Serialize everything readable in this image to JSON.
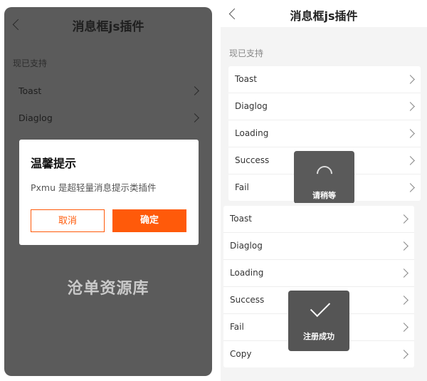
{
  "left_screen": {
    "title": "消息框js插件",
    "section_label": "现已支持",
    "items": [
      {
        "label": "Toast"
      },
      {
        "label": "Diaglog"
      }
    ],
    "watermark": "沧单资源库",
    "dialog": {
      "title": "温馨提示",
      "message": "Pxmu 是超轻量消息提示类插件",
      "cancel_label": "取消",
      "confirm_label": "确定"
    }
  },
  "right_top_screen": {
    "title": "消息框js插件",
    "section_label": "现已支持",
    "items": [
      {
        "label": "Toast"
      },
      {
        "label": "Diaglog"
      },
      {
        "label": "Loading"
      },
      {
        "label": "Success"
      },
      {
        "label": "Fail"
      }
    ],
    "loading_toast": {
      "text": "请稍等"
    }
  },
  "right_bottom_screen": {
    "items": [
      {
        "label": "Toast"
      },
      {
        "label": "Diaglog"
      },
      {
        "label": "Loading"
      },
      {
        "label": "Success"
      },
      {
        "label": "Fail"
      },
      {
        "label": "Copy"
      }
    ],
    "success_toast": {
      "text": "注册成功"
    }
  },
  "colors": {
    "accent": "#ff5a0a",
    "overlay": "#5b5b5b",
    "toast_bg": "#555555"
  }
}
